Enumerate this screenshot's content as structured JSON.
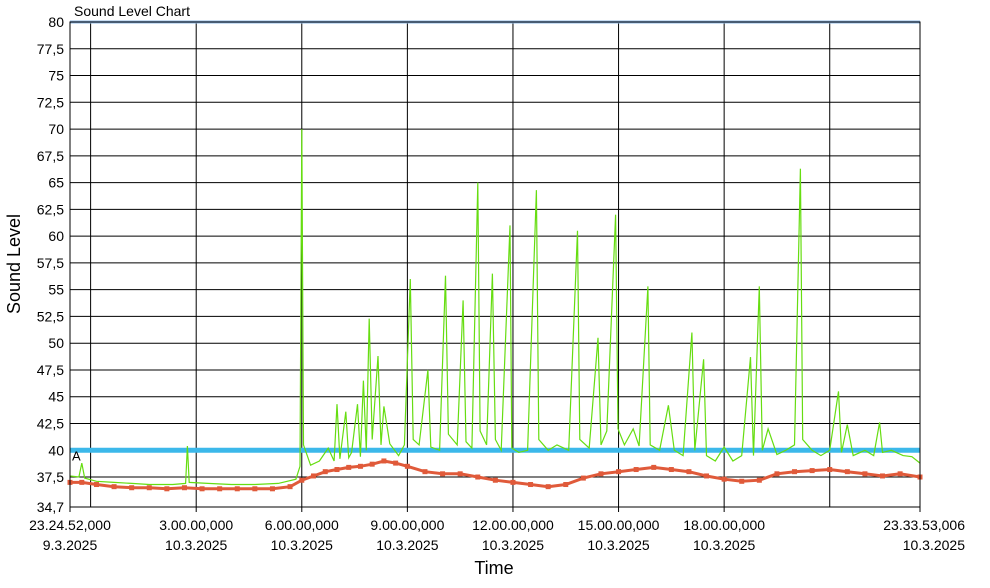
{
  "chart_data": {
    "type": "line",
    "title": "Sound Level Chart",
    "xlabel": "Time",
    "ylabel": "Sound Level",
    "ylim": [
      34.7,
      80
    ],
    "y_ticks": [
      "80",
      "77,5",
      "75",
      "72,5",
      "70",
      "67,5",
      "65",
      "62,5",
      "60",
      "57,5",
      "55",
      "52,5",
      "50",
      "47,5",
      "45",
      "42,5",
      "40",
      "37,5",
      "34,7"
    ],
    "y_tick_values": [
      80,
      77.5,
      75,
      72.5,
      70,
      67.5,
      65,
      62.5,
      60,
      57.5,
      55,
      52.5,
      50,
      47.5,
      45,
      42.5,
      40,
      37.5,
      34.7
    ],
    "x_start": "2025-03-09T23:24:52",
    "x_end": "2025-03-10T23:33:53",
    "x_ticks": [
      {
        "t": "2025-03-09T23:24:52",
        "line1": "23.24.52,000",
        "line2": "9.3.2025"
      },
      {
        "t": "2025-03-10T03:00:00",
        "line1": "3.00.00,000",
        "line2": "10.3.2025"
      },
      {
        "t": "2025-03-10T06:00:00",
        "line1": "6.00.00,000",
        "line2": "10.3.2025"
      },
      {
        "t": "2025-03-10T09:00:00",
        "line1": "9.00.00,000",
        "line2": "10.3.2025"
      },
      {
        "t": "2025-03-10T12:00:00",
        "line1": "12.00.00,000",
        "line2": "10.3.2025"
      },
      {
        "t": "2025-03-10T15:00:00",
        "line1": "15.00.00,000",
        "line2": "10.3.2025"
      },
      {
        "t": "2025-03-10T18:00:00",
        "line1": "18.00.00,000",
        "line2": "10.3.2025"
      },
      {
        "t": "2025-03-10T23:33:53",
        "line1": "23.33.53,006",
        "line2": "10.3.2025"
      }
    ],
    "x_gridlines": [
      "2025-03-10T00:00:00",
      "2025-03-10T03:00:00",
      "2025-03-10T06:00:00",
      "2025-03-10T09:00:00",
      "2025-03-10T12:00:00",
      "2025-03-10T15:00:00",
      "2025-03-10T18:00:00",
      "2025-03-10T21:00:00"
    ],
    "threshold_lines": [
      {
        "y": 80,
        "color": "#8fb8e6"
      },
      {
        "y": 40,
        "color": "#3cb8ea"
      }
    ],
    "annotation": {
      "text": "A",
      "t": "2025-03-09T23:24:52",
      "y": 39.5
    },
    "colors": {
      "peak_line": "#66dd11",
      "average_markers": "#e05a3a"
    },
    "series": [
      {
        "type": "peak_line",
        "points": [
          [
            "2025-03-09T23:24:52",
            37.6
          ],
          [
            "2025-03-09T23:40:00",
            37.5
          ],
          [
            "2025-03-09T23:45:00",
            38.8
          ],
          [
            "2025-03-09T23:50:00",
            37.4
          ],
          [
            "2025-03-10T00:10:00",
            37.1
          ],
          [
            "2025-03-10T00:40:00",
            37.0
          ],
          [
            "2025-03-10T01:10:00",
            36.9
          ],
          [
            "2025-03-10T01:40:00",
            36.8
          ],
          [
            "2025-03-10T02:20:00",
            36.8
          ],
          [
            "2025-03-10T02:42:00",
            36.9
          ],
          [
            "2025-03-10T02:45:00",
            40.4
          ],
          [
            "2025-03-10T02:48:00",
            37.0
          ],
          [
            "2025-03-10T03:20:00",
            36.9
          ],
          [
            "2025-03-10T04:00:00",
            36.8
          ],
          [
            "2025-03-10T04:40:00",
            36.8
          ],
          [
            "2025-03-10T05:20:00",
            36.9
          ],
          [
            "2025-03-10T05:50:00",
            37.3
          ],
          [
            "2025-03-10T05:57:00",
            38.5
          ],
          [
            "2025-03-10T06:00:00",
            70.0
          ],
          [
            "2025-03-10T06:03:00",
            40.5
          ],
          [
            "2025-03-10T06:15:00",
            38.6
          ],
          [
            "2025-03-10T06:30:00",
            39.0
          ],
          [
            "2025-03-10T06:45:00",
            40.2
          ],
          [
            "2025-03-10T06:55:00",
            39.0
          ],
          [
            "2025-03-10T07:00:00",
            44.3
          ],
          [
            "2025-03-10T07:05:00",
            39.2
          ],
          [
            "2025-03-10T07:15:00",
            43.6
          ],
          [
            "2025-03-10T07:20:00",
            39.3
          ],
          [
            "2025-03-10T07:25:00",
            39.8
          ],
          [
            "2025-03-10T07:35:00",
            44.3
          ],
          [
            "2025-03-10T07:40:00",
            39.4
          ],
          [
            "2025-03-10T07:45:00",
            46.5
          ],
          [
            "2025-03-10T07:50:00",
            40.0
          ],
          [
            "2025-03-10T07:55:00",
            52.3
          ],
          [
            "2025-03-10T08:00:00",
            41.0
          ],
          [
            "2025-03-10T08:10:00",
            48.8
          ],
          [
            "2025-03-10T08:15:00",
            40.5
          ],
          [
            "2025-03-10T08:20:00",
            44.1
          ],
          [
            "2025-03-10T08:30:00",
            40.6
          ],
          [
            "2025-03-10T08:45:00",
            39.5
          ],
          [
            "2025-03-10T08:55:00",
            40.5
          ],
          [
            "2025-03-10T09:05:00",
            56.0
          ],
          [
            "2025-03-10T09:10:00",
            41.0
          ],
          [
            "2025-03-10T09:20:00",
            40.5
          ],
          [
            "2025-03-10T09:35:00",
            47.5
          ],
          [
            "2025-03-10T09:40:00",
            40.3
          ],
          [
            "2025-03-10T09:55:00",
            40.0
          ],
          [
            "2025-03-10T10:05:00",
            56.3
          ],
          [
            "2025-03-10T10:10:00",
            41.5
          ],
          [
            "2025-03-10T10:25:00",
            40.5
          ],
          [
            "2025-03-10T10:35:00",
            54.0
          ],
          [
            "2025-03-10T10:40:00",
            40.8
          ],
          [
            "2025-03-10T10:50:00",
            40.2
          ],
          [
            "2025-03-10T11:00:00",
            65.0
          ],
          [
            "2025-03-10T11:04:00",
            41.8
          ],
          [
            "2025-03-10T11:15:00",
            40.5
          ],
          [
            "2025-03-10T11:25:00",
            56.5
          ],
          [
            "2025-03-10T11:30:00",
            41.0
          ],
          [
            "2025-03-10T11:40:00",
            40.0
          ],
          [
            "2025-03-10T11:55:00",
            61.0
          ],
          [
            "2025-03-10T11:58:00",
            40.2
          ],
          [
            "2025-03-10T12:10:00",
            39.8
          ],
          [
            "2025-03-10T12:25:00",
            40.0
          ],
          [
            "2025-03-10T12:40:00",
            64.3
          ],
          [
            "2025-03-10T12:44:00",
            41.0
          ],
          [
            "2025-03-10T13:00:00",
            40.0
          ],
          [
            "2025-03-10T13:15:00",
            40.5
          ],
          [
            "2025-03-10T13:35:00",
            40.0
          ],
          [
            "2025-03-10T13:50:00",
            60.5
          ],
          [
            "2025-03-10T13:54:00",
            41.0
          ],
          [
            "2025-03-10T14:10:00",
            40.2
          ],
          [
            "2025-03-10T14:25:00",
            50.5
          ],
          [
            "2025-03-10T14:30:00",
            40.5
          ],
          [
            "2025-03-10T14:40:00",
            41.8
          ],
          [
            "2025-03-10T14:55:00",
            62.0
          ],
          [
            "2025-03-10T14:59:00",
            42.0
          ],
          [
            "2025-03-10T15:10:00",
            40.5
          ],
          [
            "2025-03-10T15:25:00",
            42.0
          ],
          [
            "2025-03-10T15:35:00",
            40.4
          ],
          [
            "2025-03-10T15:50:00",
            55.3
          ],
          [
            "2025-03-10T15:54:00",
            40.5
          ],
          [
            "2025-03-10T16:10:00",
            40.0
          ],
          [
            "2025-03-10T16:25:00",
            44.2
          ],
          [
            "2025-03-10T16:35:00",
            40.0
          ],
          [
            "2025-03-10T16:50:00",
            39.5
          ],
          [
            "2025-03-10T17:05:00",
            51.0
          ],
          [
            "2025-03-10T17:10:00",
            40.0
          ],
          [
            "2025-03-10T17:25:00",
            48.5
          ],
          [
            "2025-03-10T17:30:00",
            39.5
          ],
          [
            "2025-03-10T17:45:00",
            39.0
          ],
          [
            "2025-03-10T18:00:00",
            40.3
          ],
          [
            "2025-03-10T18:15:00",
            39.0
          ],
          [
            "2025-03-10T18:30:00",
            39.5
          ],
          [
            "2025-03-10T18:45:00",
            48.7
          ],
          [
            "2025-03-10T18:50:00",
            39.5
          ],
          [
            "2025-03-10T19:00:00",
            55.3
          ],
          [
            "2025-03-10T19:05:00",
            40.0
          ],
          [
            "2025-03-10T19:15:00",
            42.0
          ],
          [
            "2025-03-10T19:30:00",
            39.6
          ],
          [
            "2025-03-10T19:45:00",
            40.0
          ],
          [
            "2025-03-10T20:00:00",
            40.5
          ],
          [
            "2025-03-10T20:10:00",
            66.3
          ],
          [
            "2025-03-10T20:14:00",
            41.0
          ],
          [
            "2025-03-10T20:30:00",
            40.0
          ],
          [
            "2025-03-10T20:45:00",
            39.5
          ],
          [
            "2025-03-10T21:00:00",
            40.0
          ],
          [
            "2025-03-10T21:15:00",
            45.5
          ],
          [
            "2025-03-10T21:20:00",
            39.8
          ],
          [
            "2025-03-10T21:30:00",
            42.4
          ],
          [
            "2025-03-10T21:40:00",
            39.5
          ],
          [
            "2025-03-10T22:00:00",
            40.0
          ],
          [
            "2025-03-10T22:15:00",
            39.5
          ],
          [
            "2025-03-10T22:25:00",
            42.6
          ],
          [
            "2025-03-10T22:30:00",
            39.8
          ],
          [
            "2025-03-10T22:45:00",
            40.0
          ],
          [
            "2025-03-10T23:05:00",
            39.5
          ],
          [
            "2025-03-10T23:20:00",
            39.4
          ],
          [
            "2025-03-10T23:33:53",
            38.8
          ]
        ]
      },
      {
        "type": "average_markers",
        "points": [
          [
            "2025-03-09T23:24:52",
            37.0
          ],
          [
            "2025-03-09T23:45:00",
            37.0
          ],
          [
            "2025-03-10T00:10:00",
            36.8
          ],
          [
            "2025-03-10T00:40:00",
            36.6
          ],
          [
            "2025-03-10T01:10:00",
            36.5
          ],
          [
            "2025-03-10T01:40:00",
            36.5
          ],
          [
            "2025-03-10T02:10:00",
            36.4
          ],
          [
            "2025-03-10T02:40:00",
            36.5
          ],
          [
            "2025-03-10T03:10:00",
            36.4
          ],
          [
            "2025-03-10T03:40:00",
            36.4
          ],
          [
            "2025-03-10T04:10:00",
            36.4
          ],
          [
            "2025-03-10T04:40:00",
            36.4
          ],
          [
            "2025-03-10T05:10:00",
            36.4
          ],
          [
            "2025-03-10T05:40:00",
            36.6
          ],
          [
            "2025-03-10T06:00:00",
            37.2
          ],
          [
            "2025-03-10T06:20:00",
            37.6
          ],
          [
            "2025-03-10T06:40:00",
            38.0
          ],
          [
            "2025-03-10T07:00:00",
            38.2
          ],
          [
            "2025-03-10T07:20:00",
            38.4
          ],
          [
            "2025-03-10T07:40:00",
            38.5
          ],
          [
            "2025-03-10T08:00:00",
            38.7
          ],
          [
            "2025-03-10T08:20:00",
            39.0
          ],
          [
            "2025-03-10T08:40:00",
            38.8
          ],
          [
            "2025-03-10T09:00:00",
            38.5
          ],
          [
            "2025-03-10T09:30:00",
            38.0
          ],
          [
            "2025-03-10T10:00:00",
            37.8
          ],
          [
            "2025-03-10T10:30:00",
            37.8
          ],
          [
            "2025-03-10T11:00:00",
            37.5
          ],
          [
            "2025-03-10T11:30:00",
            37.2
          ],
          [
            "2025-03-10T12:00:00",
            37.0
          ],
          [
            "2025-03-10T12:30:00",
            36.8
          ],
          [
            "2025-03-10T13:00:00",
            36.6
          ],
          [
            "2025-03-10T13:30:00",
            36.8
          ],
          [
            "2025-03-10T14:00:00",
            37.4
          ],
          [
            "2025-03-10T14:30:00",
            37.8
          ],
          [
            "2025-03-10T15:00:00",
            38.0
          ],
          [
            "2025-03-10T15:30:00",
            38.2
          ],
          [
            "2025-03-10T16:00:00",
            38.4
          ],
          [
            "2025-03-10T16:30:00",
            38.2
          ],
          [
            "2025-03-10T17:00:00",
            38.0
          ],
          [
            "2025-03-10T17:30:00",
            37.6
          ],
          [
            "2025-03-10T18:00:00",
            37.3
          ],
          [
            "2025-03-10T18:30:00",
            37.1
          ],
          [
            "2025-03-10T19:00:00",
            37.2
          ],
          [
            "2025-03-10T19:30:00",
            37.8
          ],
          [
            "2025-03-10T20:00:00",
            38.0
          ],
          [
            "2025-03-10T20:30:00",
            38.1
          ],
          [
            "2025-03-10T21:00:00",
            38.2
          ],
          [
            "2025-03-10T21:30:00",
            38.0
          ],
          [
            "2025-03-10T22:00:00",
            37.8
          ],
          [
            "2025-03-10T22:30:00",
            37.6
          ],
          [
            "2025-03-10T23:00:00",
            37.8
          ],
          [
            "2025-03-10T23:33:53",
            37.5
          ]
        ]
      }
    ]
  }
}
